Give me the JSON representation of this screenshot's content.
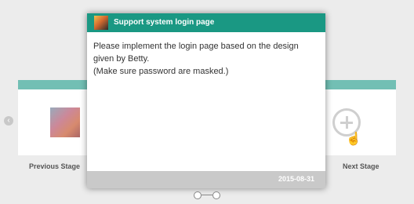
{
  "stages": {
    "previous_label": "Previous Stage",
    "next_label": "Next Stage"
  },
  "modal": {
    "title": "Support system login page",
    "body_line1": "Please implement the login page based on the design",
    "body_line2": "given by Betty.",
    "body_line3": "(Make sure password are masked.)",
    "date": "2015-08-31"
  },
  "icons": {
    "nav_left": "chevron-left-icon",
    "add": "plus-circle-icon",
    "cursor": "hand-pointer-icon"
  },
  "colors": {
    "header": "#1a9883",
    "card_top": "#72bfb4",
    "footer": "#c9c9c9"
  }
}
